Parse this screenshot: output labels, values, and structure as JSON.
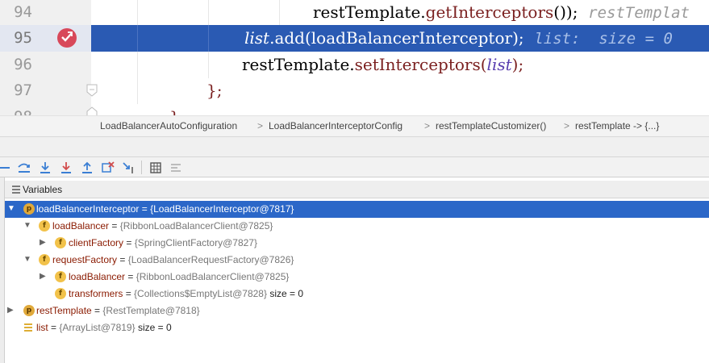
{
  "editor": {
    "lines": [
      {
        "num": "94",
        "code_method_owner": "restTemplate",
        "code_dot": ".",
        "code_method": "getInterceptors",
        "code_tail": "());",
        "hint": "restTemplat"
      },
      {
        "num": "95",
        "code_var": "list",
        "code_dot": ".",
        "code_rest": "add(loadBalancerInterceptor);",
        "hint": "list:  size = 0"
      },
      {
        "num": "96",
        "code_owner": "restTemplate",
        "code_dot": ".",
        "code_method": "setInterceptors",
        "code_open": "(",
        "code_var": "list",
        "code_close": ");"
      },
      {
        "num": "97",
        "code_text": "};"
      },
      {
        "num": "98",
        "code_text": "}"
      }
    ],
    "breakpoint_icon": "breakpoint-icon",
    "accent_selected_line": "#2a5ab3"
  },
  "breadcrumb": {
    "items": [
      "LoadBalancerAutoConfiguration",
      "LoadBalancerInterceptorConfig",
      "restTemplateCustomizer()",
      "restTemplate -> {...}"
    ],
    "separator": ">"
  },
  "debug_toolbar": {
    "buttons": [
      "step-over-icon",
      "step-into-icon",
      "force-step-into-icon",
      "step-out-icon",
      "drop-frame-icon",
      "run-to-cursor-icon",
      "evaluate-expression-icon",
      "trace-icon"
    ]
  },
  "variables": {
    "title": "Variables",
    "rows": [
      {
        "name": "loadBalancerInterceptor",
        "eq": " = ",
        "value": "{LoadBalancerInterceptor@7817}",
        "badge": "p",
        "extra": ""
      },
      {
        "name": "loadBalancer",
        "eq": " = ",
        "value": "{RibbonLoadBalancerClient@7825}",
        "badge": "f",
        "extra": ""
      },
      {
        "name": "clientFactory",
        "eq": " = ",
        "value": "{SpringClientFactory@7827}",
        "badge": "f",
        "extra": ""
      },
      {
        "name": "requestFactory",
        "eq": " = ",
        "value": "{LoadBalancerRequestFactory@7826}",
        "badge": "f",
        "extra": ""
      },
      {
        "name": "loadBalancer",
        "eq": " = ",
        "value": "{RibbonLoadBalancerClient@7825}",
        "badge": "f",
        "extra": ""
      },
      {
        "name": "transformers",
        "eq": " = ",
        "value": "{Collections$EmptyList@7828}",
        "badge": "f",
        "extra": "  size = 0"
      },
      {
        "name": "restTemplate",
        "eq": " = ",
        "value": "{RestTemplate@7818}",
        "badge": "p",
        "extra": ""
      },
      {
        "name": "list",
        "eq": " = ",
        "value": "{ArrayList@7819}",
        "badge": "list",
        "extra": "  size = 0"
      }
    ]
  }
}
